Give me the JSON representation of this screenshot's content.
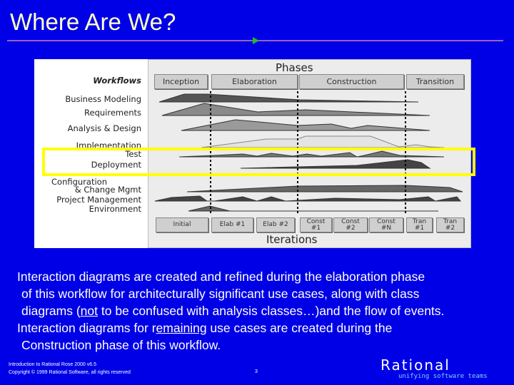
{
  "slide": {
    "title": "Where Are We?",
    "accent_color": "#0000e6",
    "title_color": "#ffffcc"
  },
  "figure": {
    "phases_title": "Phases",
    "workflows_title": "Workflows",
    "phases": [
      "Inception",
      "Elaboration",
      "Construction",
      "Transition"
    ],
    "workflows": [
      "Business Modeling",
      "Requirements",
      "Analysis & Design",
      "Implementation",
      "Test",
      "Deployment",
      "Configuration",
      "& Change Mgmt",
      "Project Management",
      "Environment"
    ],
    "iterations": [
      {
        "line1": "Initial",
        "line2": ""
      },
      {
        "line1": "Elab #1",
        "line2": ""
      },
      {
        "line1": "Elab #2",
        "line2": ""
      },
      {
        "line1": "Const",
        "line2": "#1"
      },
      {
        "line1": "Const",
        "line2": "#2"
      },
      {
        "line1": "Const",
        "line2": "#N"
      },
      {
        "line1": "Tran",
        "line2": "#1"
      },
      {
        "line1": "Tran",
        "line2": "#2"
      }
    ],
    "iterations_title": "Iterations",
    "highlighted_workflows": [
      "Test",
      "Deployment"
    ],
    "highlight_color": "#ffff00"
  },
  "body": {
    "line1": "Interaction diagrams are created and refined during the elaboration phase",
    "line2": "of this workflow for architecturally significant use cases, along with class",
    "line3_a": "diagrams (",
    "line3_u": "not",
    "line3_b": " to be confused with analysis classes…)and the flow of events.",
    "line4_a": "Interaction diagrams for r",
    "line4_u": "emaining",
    "line4_b": " use cases are created during the",
    "line5": "Construction phase of this workflow."
  },
  "footer": {
    "course": "Introduction to Rational Rose 2000 v6.5",
    "copyright": "Copyright © 1999 Rational Software, all rights reserved",
    "page_number": "3",
    "logo_text": "Rational",
    "tagline": "unifying software teams"
  }
}
